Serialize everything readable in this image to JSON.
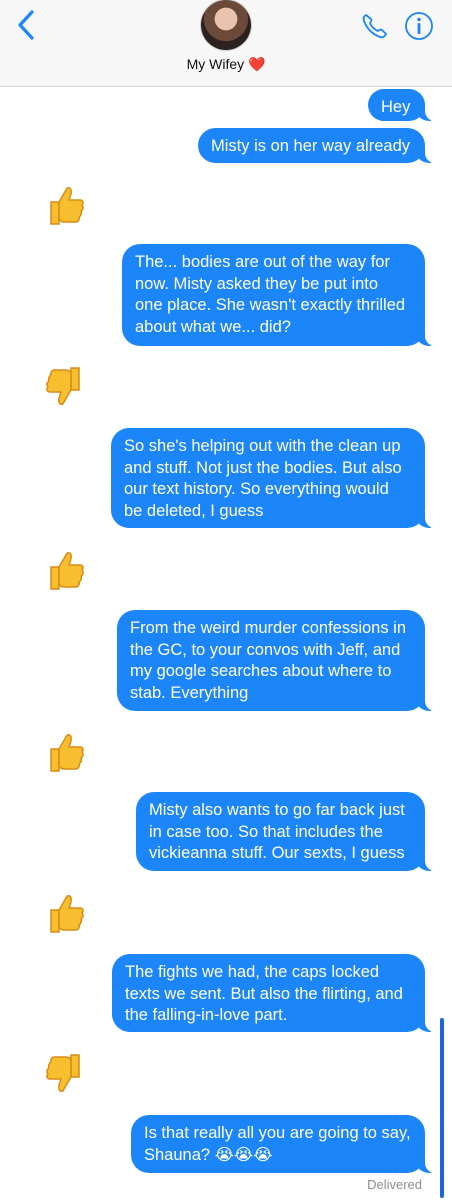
{
  "header": {
    "contact_name": "My Wifey ❤️",
    "icons": {
      "back": "chevron-left-icon",
      "phone": "phone-icon",
      "info": "info-icon"
    },
    "accent_color": "#1c86f8"
  },
  "messages": [
    {
      "type": "sent",
      "text": "Hey"
    },
    {
      "type": "sent",
      "text": "Misty is on her way already"
    },
    {
      "type": "reaction",
      "emoji": "thumbs-up-icon"
    },
    {
      "type": "sent",
      "lines": [
        "The... bodies are out of the way for",
        "now. Misty asked they be put into",
        "one place. She wasn't exactly thrilled",
        "about what we... did?"
      ]
    },
    {
      "type": "reaction",
      "emoji": "thumbs-down-icon"
    },
    {
      "type": "sent",
      "lines": [
        "So she's helping out with the clean up",
        "and stuff. Not just the bodies. But also",
        "our text history. So everything would",
        "be deleted, I guess"
      ]
    },
    {
      "type": "reaction",
      "emoji": "thumbs-up-icon"
    },
    {
      "type": "sent",
      "lines": [
        "From the weird murder confessions in",
        "the GC, to your convos with Jeff, and",
        "my google searches about where to",
        "stab. Everything"
      ]
    },
    {
      "type": "reaction",
      "emoji": "thumbs-up-icon"
    },
    {
      "type": "sent",
      "lines": [
        "Misty also wants to go far back just",
        "in case too. So that includes the",
        "vickieanna stuff. Our sexts, I guess"
      ]
    },
    {
      "type": "reaction",
      "emoji": "thumbs-up-icon"
    },
    {
      "type": "sent",
      "lines": [
        "The fights we had, the caps locked",
        "texts we sent. But also the flirting, and",
        "the falling-in-love part."
      ]
    },
    {
      "type": "reaction",
      "emoji": "thumbs-down-icon"
    },
    {
      "type": "sent",
      "lines": [
        "Is that really all you are going to say,",
        "Shauna? 😭😭😭"
      ]
    }
  ],
  "status": "Delivered"
}
